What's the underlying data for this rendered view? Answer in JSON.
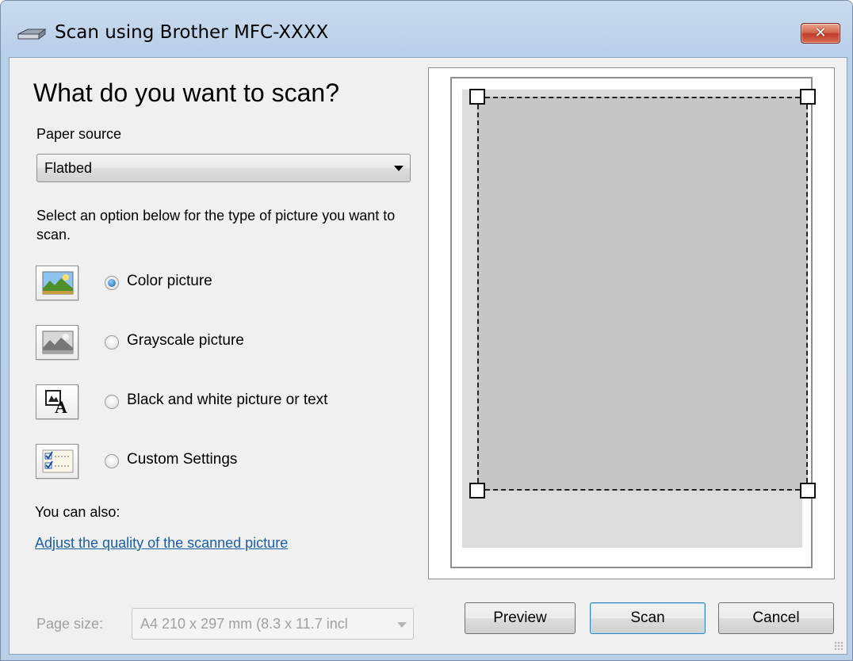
{
  "window": {
    "title": "Scan using Brother MFC-XXXX",
    "close_symbol": "✕"
  },
  "main": {
    "heading": "What do you want to scan?",
    "paper_source_label": "Paper source",
    "paper_source_value": "Flatbed",
    "description": "Select an option below for the type of picture you want to scan.",
    "options": [
      {
        "label": "Color picture",
        "selected": true,
        "icon": "color-picture-icon"
      },
      {
        "label": "Grayscale picture",
        "selected": false,
        "icon": "grayscale-picture-icon"
      },
      {
        "label": "Black and white picture or text",
        "selected": false,
        "icon": "black-white-text-icon"
      },
      {
        "label": "Custom Settings",
        "selected": false,
        "icon": "custom-settings-icon"
      }
    ],
    "also_label": "You can also:",
    "adjust_link": "Adjust the quality of the scanned picture",
    "page_size_label": "Page size:",
    "page_size_value": "A4 210 x 297 mm (8.3 x 11.7 incl"
  },
  "buttons": {
    "preview": "Preview",
    "scan": "Scan",
    "cancel": "Cancel"
  }
}
